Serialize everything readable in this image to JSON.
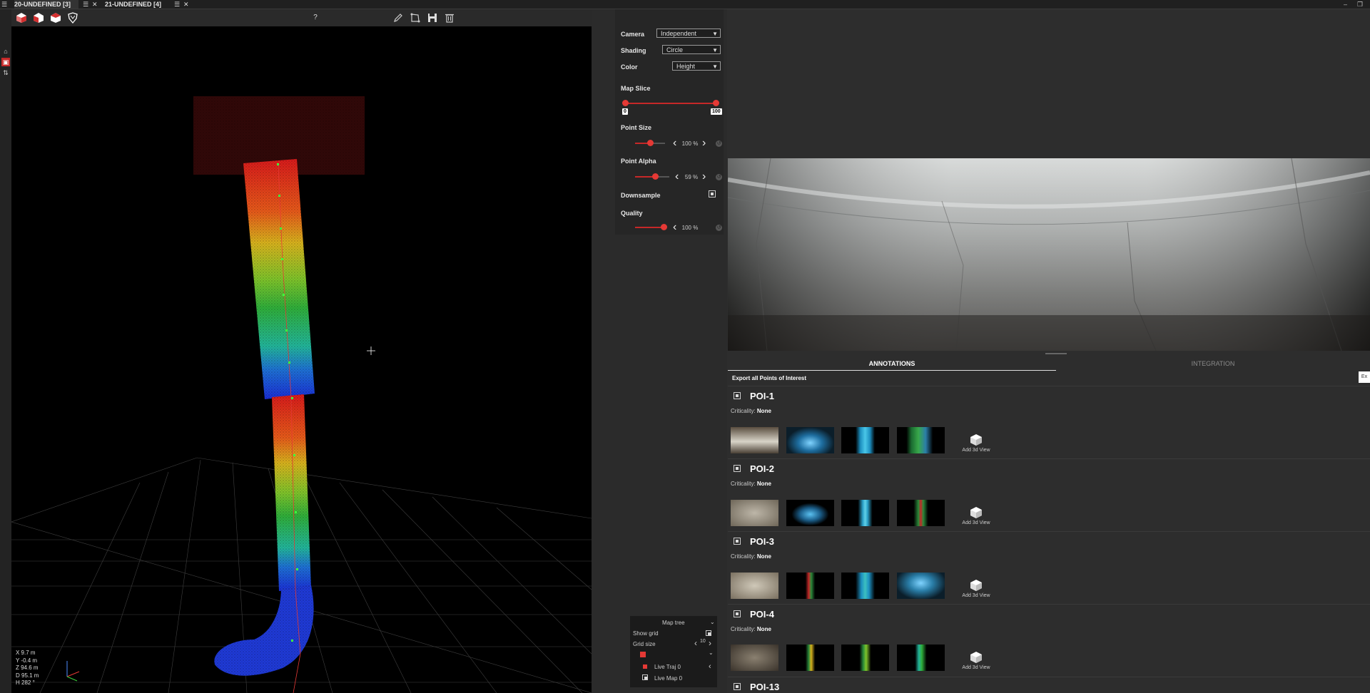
{
  "tabs": [
    {
      "label": "20-UNDEFINED [3]"
    },
    {
      "label": "21-UNDEFINED [4]"
    }
  ],
  "toolbar": {
    "help_label": "?"
  },
  "settings": {
    "camera_label": "Camera",
    "camera_value": "Independent",
    "shading_label": "Shading",
    "shading_value": "Circle",
    "color_label": "Color",
    "color_value": "Height",
    "map_slice_label": "Map Slice",
    "map_slice_min": "0",
    "map_slice_max": "100",
    "point_size_label": "Point Size",
    "point_size_value": "100 %",
    "point_size_level": 0.5,
    "point_alpha_label": "Point Alpha",
    "point_alpha_value": "59 %",
    "point_alpha_level": 0.59,
    "downsample_label": "Downsample",
    "quality_label": "Quality",
    "quality_value": "100 %",
    "quality_level": 1.0
  },
  "maptree": {
    "title": "Map tree",
    "show_grid": "Show grid",
    "grid_size": "Grid size",
    "grid_size_value": "10",
    "live_traj": "Live Traj 0",
    "live_map": "Live Map 0"
  },
  "coords": {
    "x": "X 9.7 m",
    "y": "Y -0.4 m",
    "z": "Z 94.6 m",
    "d": "D 95.1 m",
    "h": "H 282 °"
  },
  "annotations_panel": {
    "tab_annotations": "ANNOTATIONS",
    "tab_integration": "INTEGRATION",
    "export_label": "Export all Points of Interest",
    "edge_button": "Ex",
    "criticality_label": "Criticality:",
    "add_view_label": "Add 3d View"
  },
  "pois": [
    {
      "title": "POI-1",
      "criticality": "None"
    },
    {
      "title": "POI-2",
      "criticality": "None"
    },
    {
      "title": "POI-3",
      "criticality": "None"
    },
    {
      "title": "POI-4",
      "criticality": "None"
    },
    {
      "title": "POI-13",
      "criticality": ""
    }
  ],
  "colors": {
    "accent": "#e53935",
    "background": "#2b2b2b",
    "viewport": "#000000"
  }
}
